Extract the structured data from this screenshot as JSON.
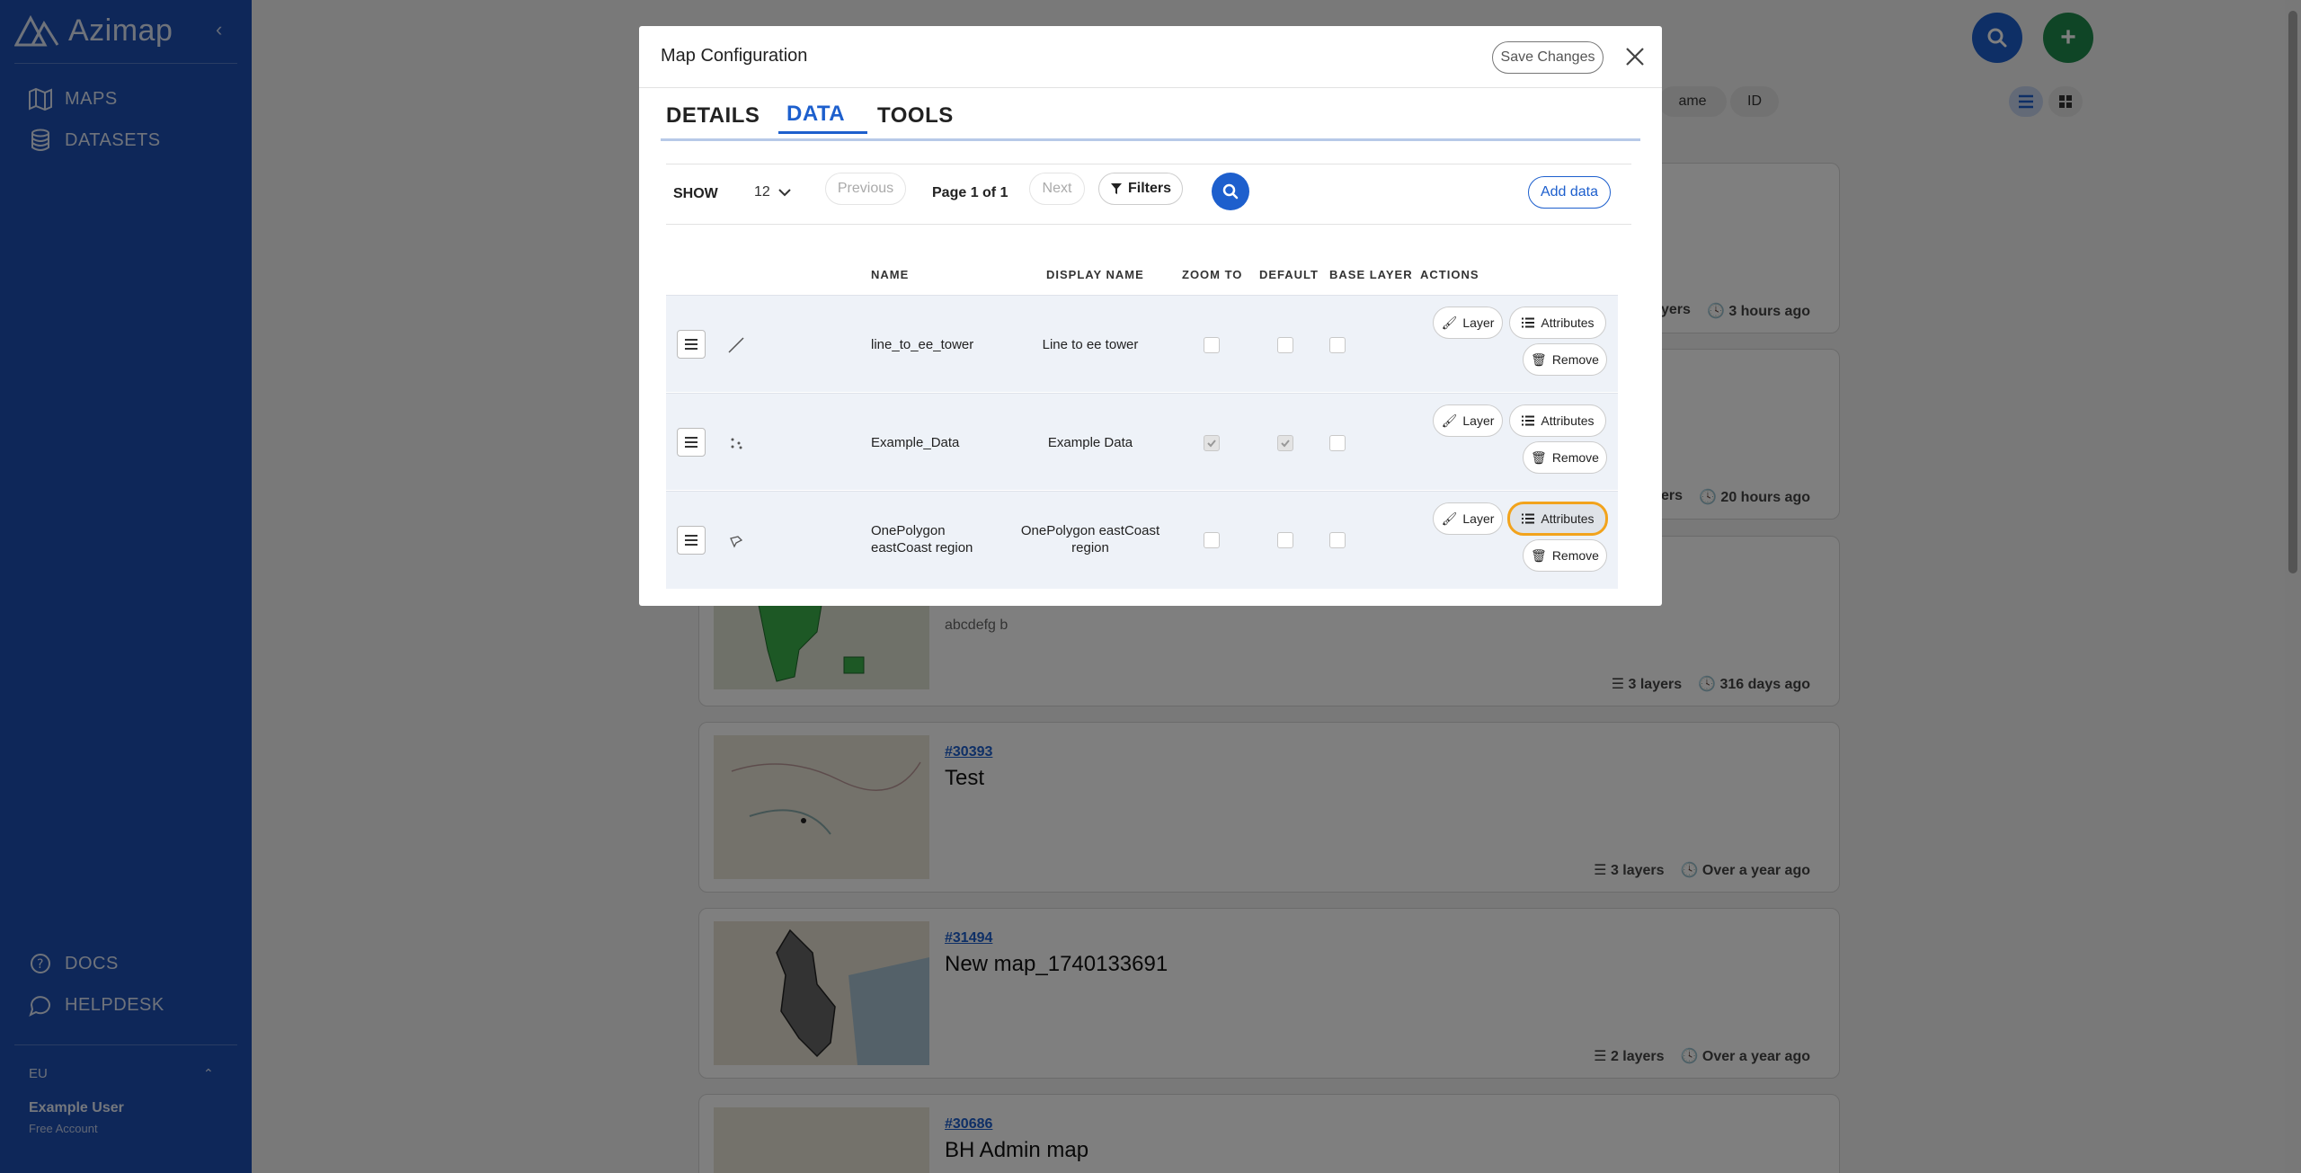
{
  "app": {
    "logo_text": "Azimap",
    "nav": [
      {
        "label": "MAPS"
      },
      {
        "label": "DATASETS"
      }
    ],
    "bottom_nav": [
      {
        "label": "DOCS"
      },
      {
        "label": "HELPDESK"
      }
    ],
    "region": "EU",
    "user_name": "Example User",
    "user_plan": "Free Account"
  },
  "background": {
    "sort_buttons": [
      "ame",
      "ID"
    ],
    "cards": [
      {
        "meta_layers": "ayers",
        "meta_time": "3 hours ago"
      },
      {
        "meta_layers": "ayers",
        "meta_time": "20 hours ago"
      },
      {
        "desc": "abcdefg b",
        "meta_layers": "3 layers",
        "meta_time": "316 days ago"
      },
      {
        "id": "#30393",
        "title": "Test",
        "meta_layers": "3 layers",
        "meta_time": "Over a year ago"
      },
      {
        "id": "#31494",
        "title": "New map_1740133691",
        "meta_layers": "2 layers",
        "meta_time": "Over a year ago"
      },
      {
        "id": "#30686",
        "title": "BH Admin map"
      }
    ]
  },
  "modal": {
    "title": "Map Configuration",
    "save_label": "Save Changes",
    "tabs": [
      {
        "label": "DETAILS"
      },
      {
        "label": "DATA"
      },
      {
        "label": "TOOLS"
      }
    ],
    "active_tab": "DATA",
    "toolbar": {
      "show_label": "SHOW",
      "show_value": "12",
      "previous_label": "Previous",
      "page_info": "Page 1 of 1",
      "next_label": "Next",
      "filters_label": "Filters",
      "add_data_label": "Add data"
    },
    "columns": [
      "NAME",
      "DISPLAY NAME",
      "ZOOM TO",
      "DEFAULT",
      "BASE LAYER",
      "ACTIONS"
    ],
    "rows": [
      {
        "geometry": "line",
        "name": "line_to_ee_tower",
        "display_name": "Line to ee tower",
        "zoom_to": false,
        "default": false,
        "base_layer": false
      },
      {
        "geometry": "point",
        "name": "Example_Data",
        "display_name": "Example Data",
        "zoom_to": true,
        "default": true,
        "base_layer": false
      },
      {
        "geometry": "polygon",
        "name": "OnePolygon eastCoast region",
        "display_name": "OnePolygon eastCoast region",
        "zoom_to": false,
        "default": false,
        "base_layer": false
      }
    ],
    "actions": {
      "layer_label": "Layer",
      "attributes_label": "Attributes",
      "remove_label": "Remove"
    }
  },
  "colors": {
    "sidebar": "#1c4fb3",
    "accent": "#1d5fcd",
    "add_button": "#1f8a4c",
    "focus_outline": "#f2a31c"
  }
}
